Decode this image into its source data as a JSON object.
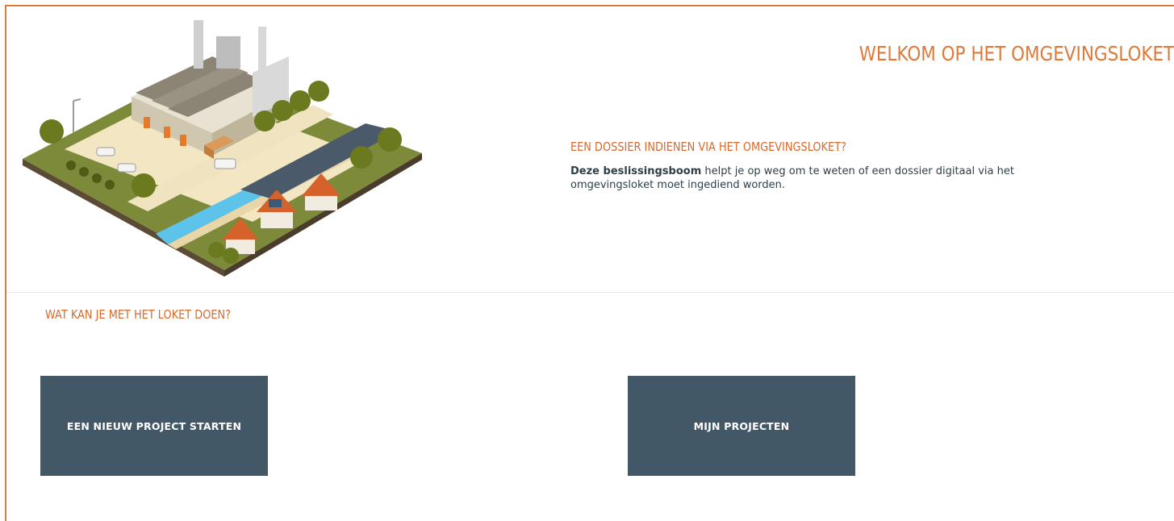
{
  "header": {
    "welcome_title": "WELKOM OP HET OMGEVINGSLOKET"
  },
  "intro": {
    "heading": "EEN DOSSIER INDIENEN VIA HET OMGEVINGSLOKET?",
    "link_text": "Deze beslissingsboom",
    "body_text": " helpt je op weg om te weten of een dossier digitaal via het omgevingsloket moet ingediend worden."
  },
  "actions": {
    "heading": "WAT KAN JE MET HET LOKET DOEN?",
    "new_project_label": "EEN NIEUW PROJECT STARTEN",
    "my_projects_label": "MIJN PROJECTEN"
  },
  "colors": {
    "accent_orange": "#dd7a3a",
    "tile_slate": "#425866",
    "body_text": "#2e3f4a"
  },
  "icons": [
    "industrial-town-illustration"
  ]
}
